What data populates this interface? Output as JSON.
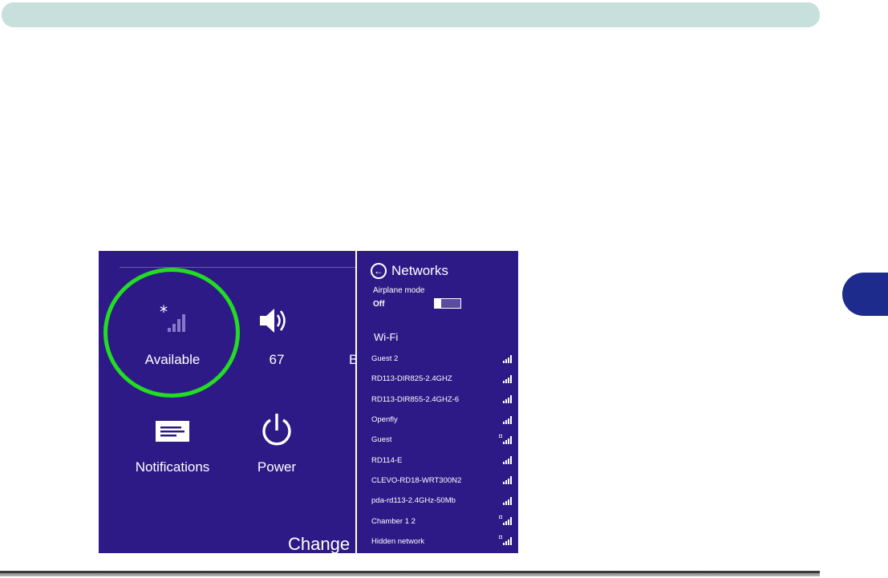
{
  "charms": {
    "network_tile": {
      "label": "Available",
      "icon": "wifi-signal-available-icon"
    },
    "volume_tile": {
      "label": "67",
      "icon": "speaker-icon"
    },
    "partial_tile": {
      "label": "B"
    },
    "notifications_tile": {
      "label": "Notifications",
      "icon": "notifications-icon"
    },
    "power_tile": {
      "label": "Power",
      "icon": "power-icon"
    },
    "bottom_text": "Change I"
  },
  "networks_panel": {
    "title": "Networks",
    "airplane_mode": {
      "label": "Airplane mode",
      "state": "Off"
    },
    "wifi_heading": "Wi-Fi",
    "networks": [
      {
        "name": "Guest 2",
        "secured": false
      },
      {
        "name": "RD113-DIR825-2.4GHZ",
        "secured": false
      },
      {
        "name": "RD113-DIR855-2.4GHZ-6",
        "secured": false
      },
      {
        "name": "Openfly",
        "secured": false
      },
      {
        "name": "Guest",
        "secured": true
      },
      {
        "name": "RD114-E",
        "secured": false
      },
      {
        "name": "CLEVO-RD18-WRT300N2",
        "secured": false
      },
      {
        "name": "pda-rd113-2.4GHz-50Mb",
        "secured": false
      },
      {
        "name": "Chamber 1 2",
        "secured": true
      },
      {
        "name": "Hidden network",
        "secured": true
      }
    ]
  },
  "colors": {
    "panel_background": "#2e1a87",
    "highlight": "#22dd22",
    "header_bar": "#c7e0dc",
    "chapter_tab": "#1d2b8c"
  }
}
